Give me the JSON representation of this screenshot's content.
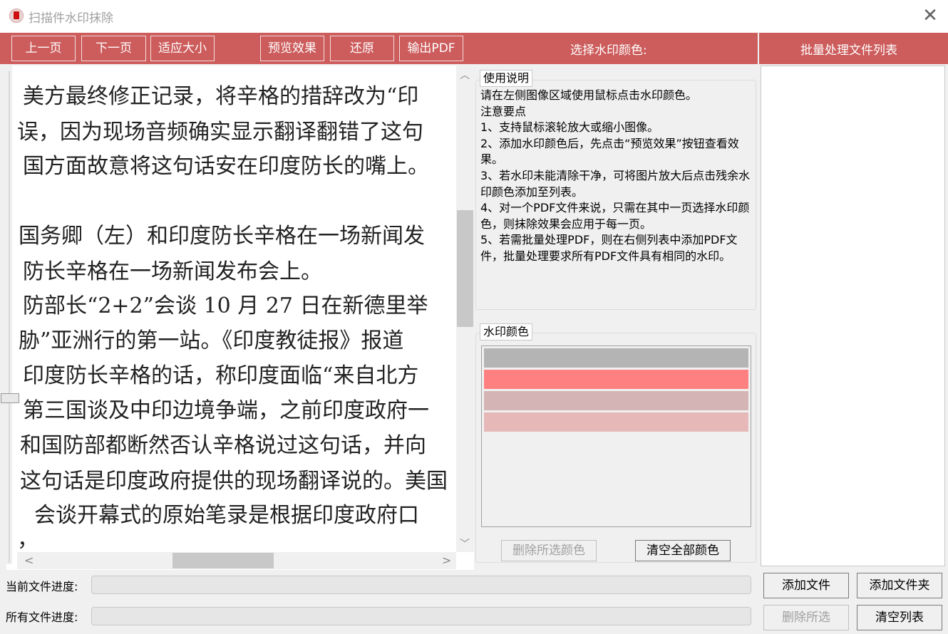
{
  "window": {
    "title": "扫描件水印抹除",
    "close_glyph": "✕"
  },
  "toolbar": {
    "prev_page": "上一页",
    "next_page": "下一页",
    "fit_size": "适应大小",
    "preview": "预览效果",
    "restore": "还原",
    "export_pdf": "输出PDF",
    "select_color_label": "选择水印颜色:",
    "batch_list_label": "批量处理文件列表"
  },
  "document_image": {
    "lines": [
      "美方最终修正记录，将辛格的措辞改为“印",
      "误，因为现场音频确实显示翻译翻错了这句",
      "国方面故意将这句话安在印度防长的嘴上。",
      "",
      "国务卿（左）和印度防长辛格在一场新闻发",
      "防长辛格在一场新闻发布会上。",
      "防部长“2+2”会谈 10 月 27 日在新德里举",
      "胁”亚洲行的第一站。《印度教徒报》报道",
      "印度防长辛格的话，称印度面临“来自北方",
      "第三国谈及中印边境争端，之前印度政府一",
      "和国防部都断然否认辛格说过这句话，并向",
      "这句话是印度政府提供的现场翻译说的。美国",
      "会谈开幕式的原始笔录是根据印度政府口",
      "，"
    ]
  },
  "instructions": {
    "group_title": "使用说明",
    "lines": [
      "请在左侧图像区域使用鼠标点击水印颜色。",
      "注意要点",
      "1、支持鼠标滚轮放大或缩小图像。",
      "2、添加水印颜色后，先点击“预览效果”按钮查看效果。",
      "3、若水印未能清除干净，可将图片放大后点击残余水印颜色添加至列表。",
      "4、对一个PDF文件来说，只需在其中一页选择水印颜色，则抹除效果会应用于每一页。",
      "5、若需批量处理PDF，则在右侧列表中添加PDF文件，批量处理要求所有PDF文件具有相同的水印。"
    ]
  },
  "watermark_colors": {
    "group_title": "水印颜色",
    "swatches": [
      "#b4b4b4",
      "#ff8080",
      "#d4b4b4",
      "#e6b8b8"
    ],
    "delete_selected": "删除所选颜色",
    "clear_all": "清空全部颜色"
  },
  "files": {
    "add_file": "添加文件",
    "add_folder": "添加文件夹",
    "delete_selected": "删除所选",
    "clear_list": "清空列表"
  },
  "progress": {
    "current_label": "当前文件进度:",
    "all_label": "所有文件进度:",
    "current_value": 0,
    "all_value": 0
  },
  "scroll": {
    "up": "︿",
    "down": "﹀",
    "left": "<",
    "right": ">"
  }
}
